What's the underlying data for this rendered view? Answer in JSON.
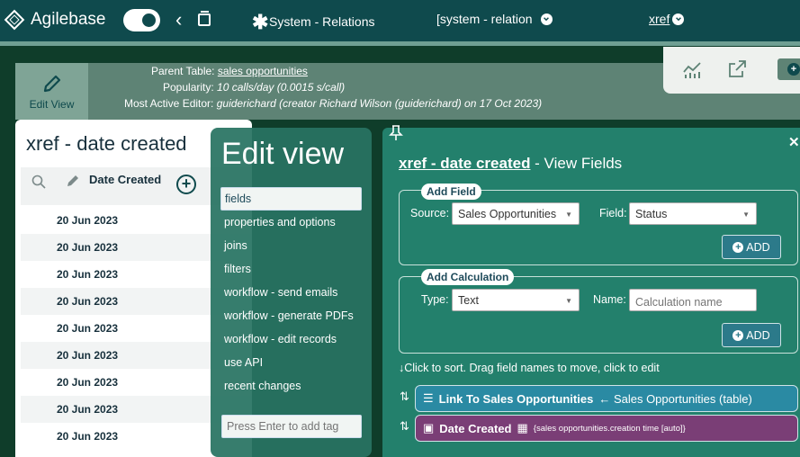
{
  "header": {
    "logo_text": "Agilebase",
    "table_name": "System - Relations",
    "view_selector": "[system - relation",
    "view_name": "xref"
  },
  "info": {
    "edit_view_label": "Edit View",
    "parent_table_label": "Parent Table:",
    "parent_table_value": "sales opportunities",
    "popularity_label": "Popularity:",
    "popularity_value": "10 calls/day (0.0015 s/call)",
    "editor_label": "Most Active Editor:",
    "editor_value": "guiderichard (creator Richard Wilson (guiderichard) on 17 Oct 2023)"
  },
  "data_view": {
    "title": "xref - date created",
    "column": "Date Created",
    "rows": [
      "20 Jun 2023",
      "20 Jun 2023",
      "20 Jun 2023",
      "20 Jun 2023",
      "20 Jun 2023",
      "20 Jun 2023",
      "20 Jun 2023",
      "20 Jun 2023",
      "20 Jun 2023"
    ]
  },
  "edit_nav": {
    "title": "Edit view",
    "items": [
      "fields",
      "properties and options",
      "joins",
      "filters",
      "workflow - send emails",
      "workflow - generate PDFs",
      "workflow - edit records",
      "use API",
      "recent changes"
    ],
    "tag_placeholder": "Press Enter to add tag"
  },
  "fields_panel": {
    "title_link": "xref - date created",
    "title_suffix": " - View Fields",
    "add_field": {
      "legend": "Add Field",
      "source_label": "Source:",
      "source_value": "Sales Opportunities",
      "field_label": "Field:",
      "field_value": "Status",
      "button": "ADD"
    },
    "add_calc": {
      "legend": "Add Calculation",
      "type_label": "Type:",
      "type_value": "Text",
      "name_label": "Name:",
      "name_placeholder": "Calculation name",
      "button": "ADD"
    },
    "hint": "Click to sort.  Drag field names to move, click to edit",
    "fields": [
      {
        "name": "Link To Sales Opportunities",
        "detail": "← Sales Opportunities (table)"
      },
      {
        "name": "Date Created",
        "detail": "{sales opportunities.creation time [auto]}"
      }
    ]
  }
}
